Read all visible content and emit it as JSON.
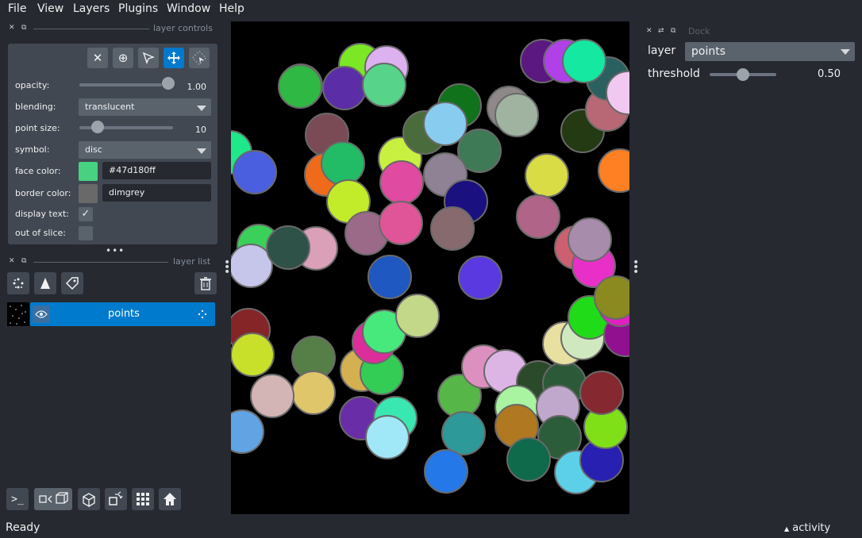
{
  "menu": [
    "File",
    "View",
    "Layers",
    "Plugins",
    "Window",
    "Help"
  ],
  "layer_controls": {
    "title": "layer controls",
    "opacity": {
      "label": "opacity:",
      "value": "1.00",
      "level": 1.0
    },
    "blending": {
      "label": "blending:",
      "value": "translucent"
    },
    "point_size": {
      "label": "point size:",
      "value": "10",
      "level": 0.15
    },
    "symbol": {
      "label": "symbol:",
      "value": "disc"
    },
    "face_color": {
      "label": "face color:",
      "value": "#47d180ff",
      "swatch": "#47d180"
    },
    "border_color": {
      "label": "border color:",
      "value": "dimgrey",
      "swatch": "#696969"
    },
    "display_text": {
      "label": "display text:",
      "checked": true
    },
    "out_of_slice": {
      "label": "out of slice:",
      "checked": false
    }
  },
  "layer_list": {
    "title": "layer list",
    "layers": [
      {
        "name": "points",
        "selected": true
      }
    ]
  },
  "dock": {
    "title": "Dock",
    "layer_label": "layer",
    "layer_value": "points",
    "threshold_label": "threshold",
    "threshold_value": "0.50",
    "threshold_level": 0.5
  },
  "status": {
    "text": "Ready",
    "activity": "activity"
  },
  "colors": {
    "accent": "#007acc",
    "bg": "#262930",
    "panel": "#414851"
  },
  "icons": [
    "close-icon",
    "add-icon",
    "select-icon",
    "pan-zoom-icon",
    "transform-icon",
    "add-points-icon",
    "add-shapes-icon",
    "add-labels-icon",
    "delete-icon",
    "eye-icon",
    "console-icon",
    "ndisplay-icon",
    "roll-icon",
    "transpose-icon",
    "grid-icon",
    "home-icon"
  ]
}
